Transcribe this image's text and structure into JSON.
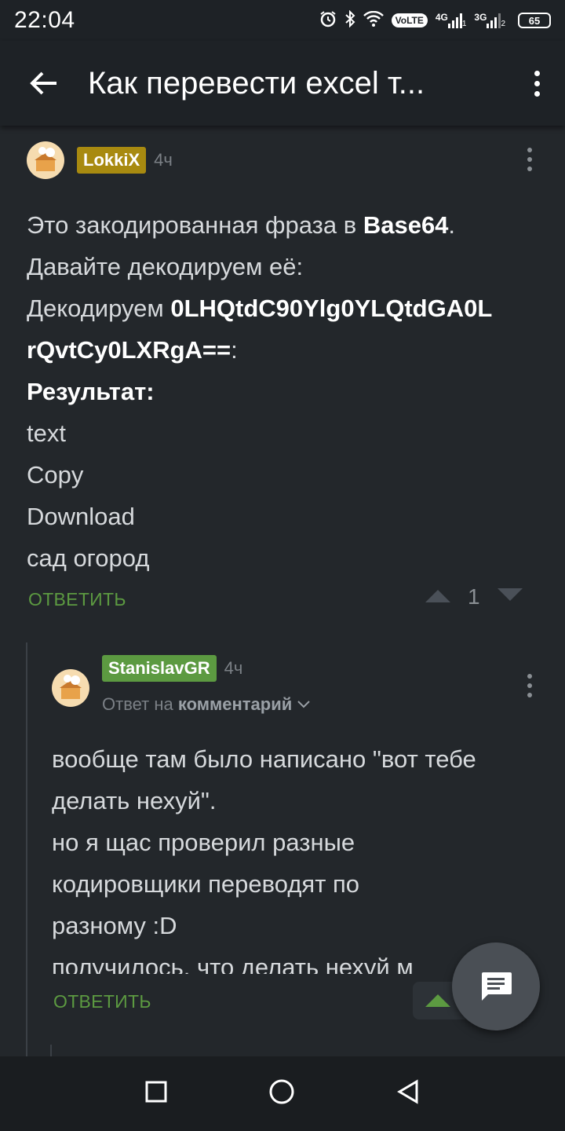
{
  "status_bar": {
    "time": "22:04",
    "volte": "VoLTE",
    "net1": "4G",
    "sim1": "1",
    "net2": "3G",
    "sim2": "2",
    "battery": "65"
  },
  "app_bar": {
    "title": "Как перевести excel т..."
  },
  "comment1": {
    "username": "LokkiX",
    "username_color": "#a88a10",
    "time": "4ч",
    "lines": {
      "l1_pre": "Это закодированная фраза в ",
      "l1_bold": "Base64",
      "l1_post": ".",
      "l2": "Давайте декодируем её:",
      "l3_pre": "Декодируем ",
      "l3_bold": "0LHQtdC90Ylg0YLQtdGA0L",
      "l4_bold": "rQvtCy0LXRgA==",
      "l4_post": ":",
      "l5_bold": "Результат:",
      "l6": "text",
      "l7": "Copy",
      "l8": "Download",
      "l9": "сад огород"
    },
    "reply_label": "ОТВЕТИТЬ",
    "votes": "1"
  },
  "comment2": {
    "username": "StanislavGR",
    "username_color": "#5c9a41",
    "time": "4ч",
    "reply_to_prefix": "Ответ на ",
    "reply_to_link": "комментарий",
    "lines": {
      "l1": "вообще там было написано \"вот тебе",
      "l2": "делать нехуй\".",
      "l3": "но я щас проверил разные",
      "l4": "кодировщики переводят по",
      "l5": "разному :D",
      "l6": "получилось, что делать нехуй м"
    },
    "reply_label": "ОТВЕТИТЬ"
  },
  "colors": {
    "accent_green": "#5c9a41",
    "background": "#23272b"
  }
}
